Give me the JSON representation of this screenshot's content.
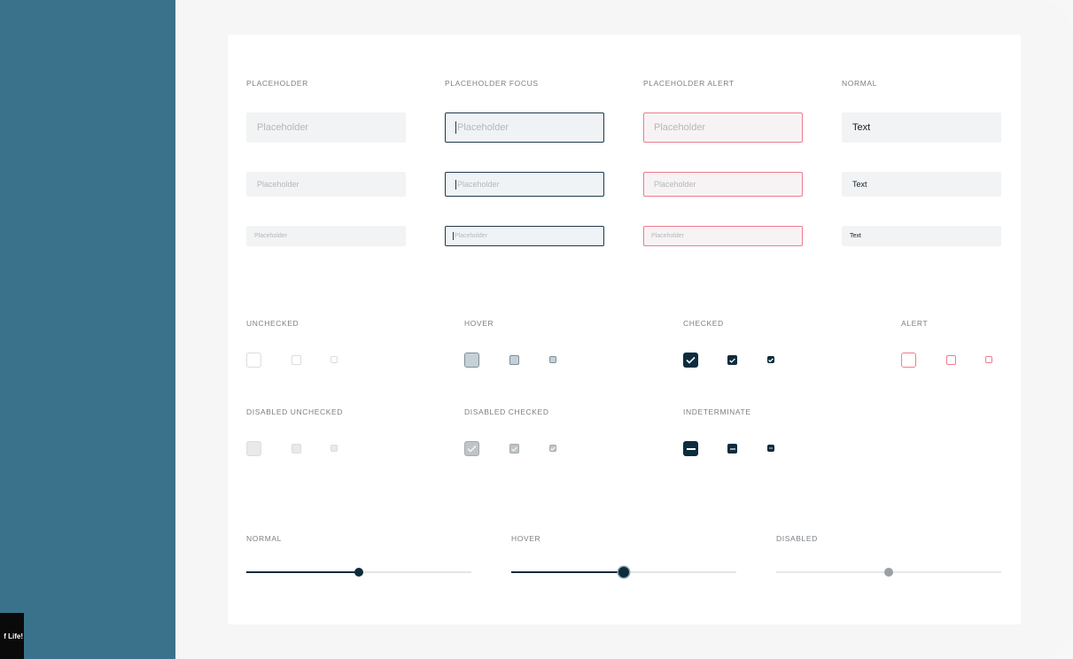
{
  "sidebar": {
    "badge_text": "f Life!"
  },
  "inputs": {
    "columns": [
      {
        "label": "PLACEHOLDER"
      },
      {
        "label": "PLACEHOLDER FOCUS"
      },
      {
        "label": "PLACEHOLDER ALERT"
      },
      {
        "label": "NORMAL"
      }
    ],
    "placeholder": "Placeholder",
    "normal_value": "Text"
  },
  "checkboxes": {
    "unchecked_label": "UNCHECKED",
    "hover_label": "HOVER",
    "checked_label": "CHECKED",
    "alert_label": "ALERT",
    "disabled_unchecked_label": "DISABLED UNCHECKED",
    "disabled_checked_label": "DISABLED CHECKED",
    "indeterminate_label": "INDETERMINATE"
  },
  "sliders": {
    "normal": {
      "label": "NORMAL",
      "value": 0.5
    },
    "hover": {
      "label": "HOVER",
      "value": 0.5
    },
    "disabled": {
      "label": "DISABLED",
      "value": 0.5
    }
  },
  "colors": {
    "sidebar": "#3b728b",
    "primary": "#0d2c3d",
    "alert": "#f07b8d",
    "focus": "#1d3a4c"
  }
}
